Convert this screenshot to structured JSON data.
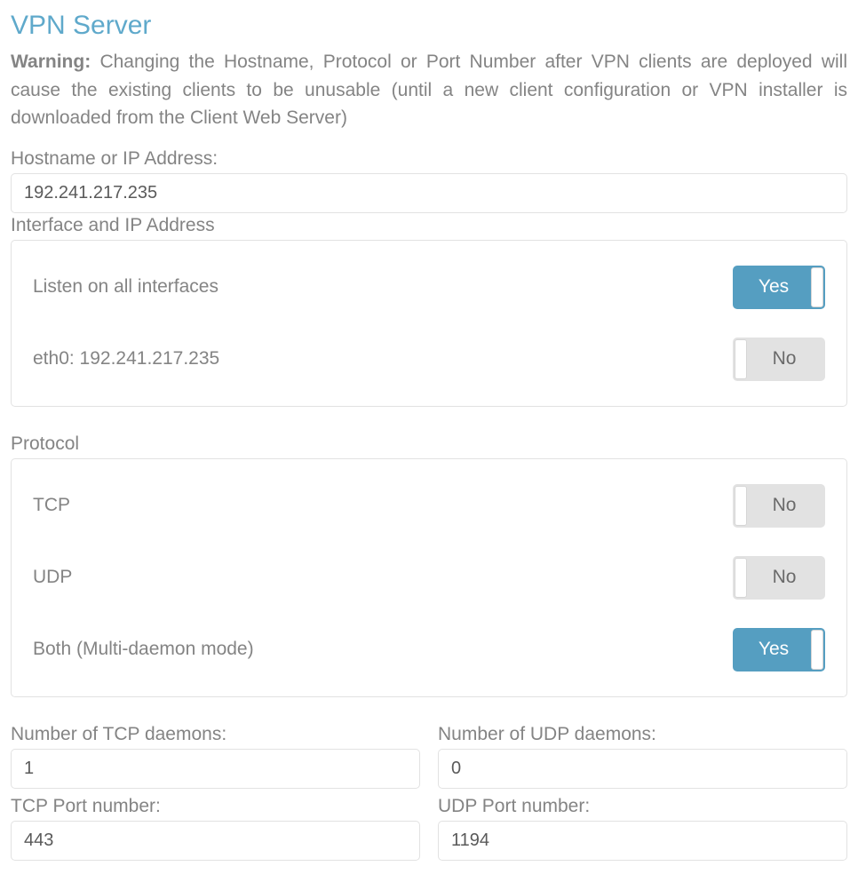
{
  "title": "VPN Server",
  "warning": {
    "label": "Warning:",
    "text": "Changing the Hostname, Protocol or Port Number after VPN clients are deployed will cause the existing clients to be unusable (until a new client configuration or VPN installer is downloaded from the Client Web Server)"
  },
  "hostname": {
    "label": "Hostname or IP Address:",
    "value": "192.241.217.235"
  },
  "interface": {
    "label": "Interface and IP Address",
    "rows": [
      {
        "label": "Listen on all interfaces",
        "state": "Yes"
      },
      {
        "label": "eth0: 192.241.217.235",
        "state": "No"
      }
    ]
  },
  "protocol": {
    "label": "Protocol",
    "rows": [
      {
        "label": "TCP",
        "state": "No"
      },
      {
        "label": "UDP",
        "state": "No"
      },
      {
        "label": "Both (Multi-daemon mode)",
        "state": "Yes"
      }
    ]
  },
  "daemons": {
    "tcp_count_label": "Number of TCP daemons:",
    "tcp_count_value": "1",
    "udp_count_label": "Number of UDP daemons:",
    "udp_count_value": "0",
    "tcp_port_label": "TCP Port number:",
    "tcp_port_value": "443",
    "udp_port_label": "UDP Port number:",
    "udp_port_value": "1194"
  },
  "toggle_labels": {
    "yes": "Yes",
    "no": "No"
  }
}
